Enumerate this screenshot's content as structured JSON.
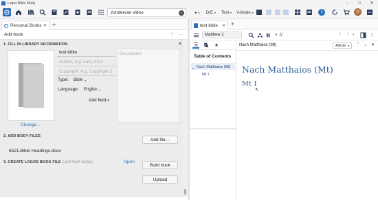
{
  "window": {
    "title": "Logos Bible Study",
    "controls": [
      "–",
      "□",
      "✕"
    ]
  },
  "toolbar": {
    "search_value": "zondervan video",
    "drop_1": "D/E",
    "drop_2": "Test",
    "drop_3": "V-Mode",
    "notification_count": "1",
    "icons": [
      "home-icon",
      "library-icon",
      "guides-icon",
      "search-icon",
      "notes-icon",
      "documents-icon",
      "factbook-icon",
      "apps-icon",
      "go-icon",
      "record-icon",
      "layout-icon",
      "sync-icon",
      "cart-icon",
      "help-icon"
    ]
  },
  "left_panel": {
    "tab_label": "Personal Books",
    "header": "Add book",
    "section1_title": "1. FILL IN LIBRARY INFORMATION",
    "title_value": "test bible",
    "author_placeholder": "Author, e.g. Last, First",
    "copyright_placeholder": "Copyright, e.g. Copyright 2",
    "description_placeholder": "Description",
    "type_label": "Type:",
    "type_value": "Bible",
    "language_label": "Language:",
    "language_value": "English",
    "add_field": "Add field",
    "change_link": "Change…",
    "section2_title": "2. ADD BODY FILES",
    "add_file_button": "Add file…",
    "file_name": "6521.Bible Headings.docx",
    "section3_title": "3. CREATE LOGOS BOOK FILE",
    "last_built": "Last built today",
    "open_link": "Open",
    "build_button": "Build book",
    "upload_button": "Upload"
  },
  "right_panel": {
    "tab_label": "test bible",
    "reference": "Matthew 1",
    "toc_title": "Table of Contents",
    "toc_items": [
      "Nach Matthaios (Mt)",
      "Mt 1"
    ],
    "reader_title": "Nach Matthaios (Mt)",
    "view_mode": "Article",
    "heading": "Nach Matthaios (Mt)",
    "subheading": "Mt 1"
  }
}
